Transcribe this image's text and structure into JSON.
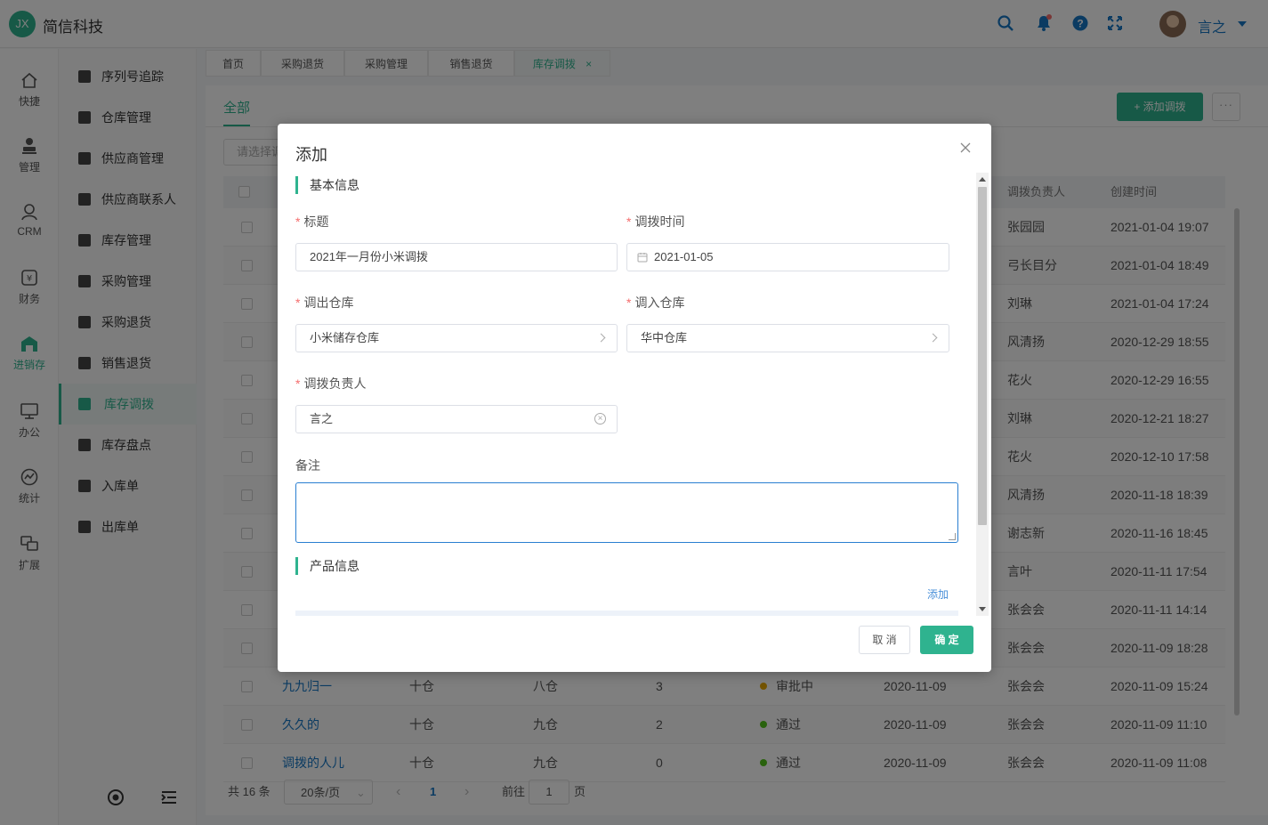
{
  "app": {
    "logo_text": "JX",
    "brand": "简信科技",
    "username": "言之"
  },
  "header_icons": [
    "search-icon",
    "bell-icon",
    "help-icon",
    "fullscreen-icon"
  ],
  "leftnav": [
    {
      "label": "快捷",
      "icon": "home-icon"
    },
    {
      "label": "管理",
      "icon": "stamp-icon"
    },
    {
      "label": "CRM",
      "icon": "user-icon"
    },
    {
      "label": "财务",
      "icon": "yuan-icon"
    },
    {
      "label": "进销存",
      "icon": "warehouse-icon",
      "active": true
    },
    {
      "label": "办公",
      "icon": "monitor-icon"
    },
    {
      "label": "统计",
      "icon": "chart-icon"
    },
    {
      "label": "扩展",
      "icon": "extend-icon"
    }
  ],
  "subnav": [
    {
      "label": "序列号追踪",
      "icon": "sn-icon"
    },
    {
      "label": "仓库管理",
      "icon": "bank-icon"
    },
    {
      "label": "供应商管理",
      "icon": "store-icon"
    },
    {
      "label": "供应商联系人",
      "icon": "person-icon"
    },
    {
      "label": "库存管理",
      "icon": "house-icon"
    },
    {
      "label": "采购管理",
      "icon": "edit-doc-icon"
    },
    {
      "label": "采购退货",
      "icon": "doc-icon"
    },
    {
      "label": "销售退货",
      "icon": "doc-icon"
    },
    {
      "label": "库存调拨",
      "icon": "doc-icon",
      "active": true
    },
    {
      "label": "库存盘点",
      "icon": "doc-icon"
    },
    {
      "label": "入库单",
      "icon": "inbox-icon"
    },
    {
      "label": "出库单",
      "icon": "outbox-icon"
    }
  ],
  "tabs": [
    "首页",
    "采购退货",
    "采购管理",
    "销售退货",
    "库存调拨"
  ],
  "tab_close": "×",
  "content": {
    "tab_all": "全部",
    "add_button": "+ 添加调拨",
    "more_button": "···",
    "filter_placeholder": "请选择调",
    "columns": [
      "调拨负责人",
      "创建时间"
    ],
    "rows": [
      {
        "owner": "张园园",
        "created": "2021-01-04 19:07"
      },
      {
        "owner": "弓长目分",
        "created": "2021-01-04 18:49"
      },
      {
        "owner": "刘琳",
        "created": "2021-01-04 17:24"
      },
      {
        "owner": "风清扬",
        "created": "2020-12-29 18:55"
      },
      {
        "owner": "花火",
        "created": "2020-12-29 16:55"
      },
      {
        "owner": "刘琳",
        "created": "2020-12-21 18:27"
      },
      {
        "owner": "花火",
        "created": "2020-12-10 17:58"
      },
      {
        "owner": "风清扬",
        "created": "2020-11-18 18:39"
      },
      {
        "owner": "谢志新",
        "created": "2020-11-16 18:45"
      },
      {
        "owner": "言叶",
        "created": "2020-11-11 17:54"
      },
      {
        "owner": "张会会",
        "created": "2020-11-11 14:14"
      },
      {
        "owner": "张会会",
        "created": "2020-11-09 18:28"
      },
      {
        "title": "九九归一",
        "from": "十仓",
        "to": "八仓",
        "qty": "3",
        "status": "审批中",
        "status_color": "#e6a700",
        "date": "2020-11-09",
        "owner": "张会会",
        "created": "2020-11-09 15:24"
      },
      {
        "title": "久久的",
        "from": "十仓",
        "to": "九仓",
        "qty": "2",
        "status": "通过",
        "status_color": "#52c41a",
        "date": "2020-11-09",
        "owner": "张会会",
        "created": "2020-11-09 11:10"
      },
      {
        "title": "调拨的人儿",
        "from": "十仓",
        "to": "九仓",
        "qty": "0",
        "status": "通过",
        "status_color": "#52c41a",
        "date": "2020-11-09",
        "owner": "张会会",
        "created": "2020-11-09 11:08"
      }
    ],
    "pager": {
      "total": "共 16 条",
      "page_size": "20条/页",
      "current_page": "1",
      "goto_label": "前往",
      "goto_value": "1",
      "page_suffix": "页",
      "prev": "‹",
      "next": "›"
    }
  },
  "modal": {
    "title": "添加",
    "close": "×",
    "section_basic": "基本信息",
    "required_mark": "*",
    "label_title": "标题",
    "value_title": "2021年一月份小米调拨",
    "label_time": "调拨时间",
    "value_time": "2021-01-05",
    "label_out": "调出仓库",
    "value_out": "小米储存仓库",
    "label_in": "调入仓库",
    "value_in": "华中仓库",
    "label_owner": "调拨负责人",
    "value_owner": "言之",
    "label_remark": "备注",
    "section_product": "产品信息",
    "add_link": "添加",
    "cancel": "取 消",
    "ok": "确 定"
  },
  "colors": {
    "accent": "#2fb38f",
    "link": "#1677c4",
    "required": "#f56c6c"
  }
}
